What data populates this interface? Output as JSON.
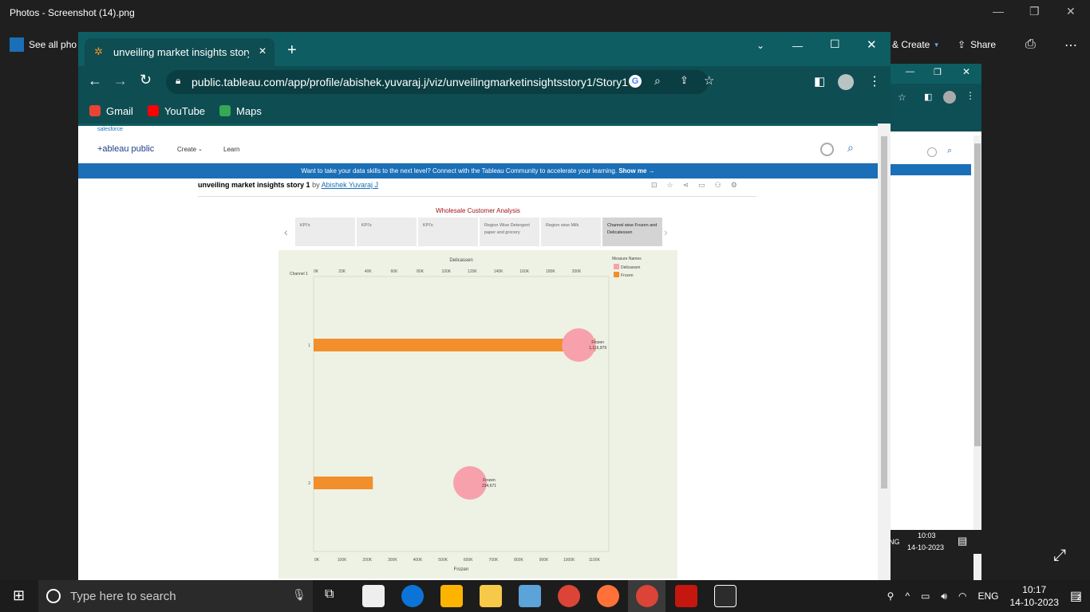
{
  "photos": {
    "title": "Photos - Screenshot (14).png",
    "see_all": "See all pho",
    "create": "& Create",
    "share": "Share"
  },
  "chrome": {
    "tab_title": "unveiling market insights story 1",
    "url": "public.tableau.com/app/profile/abishek.yuvaraj.j/viz/unveilingmarketinsightsstory1/Story1",
    "bookmarks": [
      "Gmail",
      "YouTube",
      "Maps"
    ]
  },
  "tableau": {
    "salesforce": "salesforce",
    "logo": "+ableau public",
    "nav": [
      "Create",
      "Learn"
    ],
    "banner": "Want to take your data skills to the next level? Connect with the Tableau Community to accelerate your learning.",
    "banner_link": "Show me →",
    "viz_title": "unveiling market insights story 1",
    "by": "by",
    "author": "Abishek Yuvaraj J",
    "story_title": "Wholesale Customer Analysis",
    "story_points": [
      "KPI's",
      "KPI's",
      "KPI's",
      "Region Wise Detergent paper and grocery",
      "Region wise Milk",
      "Channel wise Frozen and Delicatessen"
    ]
  },
  "chart_data": {
    "type": "bar",
    "title": "Delicassen",
    "xlabel": "Frozen",
    "row_header": "Channel",
    "categories": [
      "1",
      "2"
    ],
    "top_axis_ticks": [
      "0K",
      "20K",
      "40K",
      "60K",
      "80K",
      "100K",
      "120K",
      "140K",
      "160K",
      "180K",
      "200K"
    ],
    "bottom_axis_ticks": [
      "0K",
      "100K",
      "200K",
      "300K",
      "400K",
      "500K",
      "600K",
      "700K",
      "800K",
      "900K",
      "1000K",
      "1100K"
    ],
    "legend_title": "Measure Names",
    "series": [
      {
        "name": "Delicassen",
        "values": [
          421955,
          248988
        ],
        "color": "#f7a1ad",
        "mark": "circle"
      },
      {
        "name": "Frozen",
        "values": [
          1116979,
          234671
        ],
        "color": "#f28e2b",
        "mark": "bar"
      }
    ],
    "labels": [
      {
        "measure": "Frozen",
        "value": "1,116,979"
      },
      {
        "measure": "Frozen",
        "value": "234,671"
      }
    ],
    "top_xlim": [
      0,
      470000
    ],
    "bottom_xlim": [
      0,
      1170000
    ]
  },
  "taskbar": {
    "search_placeholder": "Type here to search",
    "lang": "ENG",
    "time": "10:17",
    "date": "14-10-2023",
    "bg_time": "10:03",
    "bg_date": "14-10-2023",
    "notif": "2"
  }
}
